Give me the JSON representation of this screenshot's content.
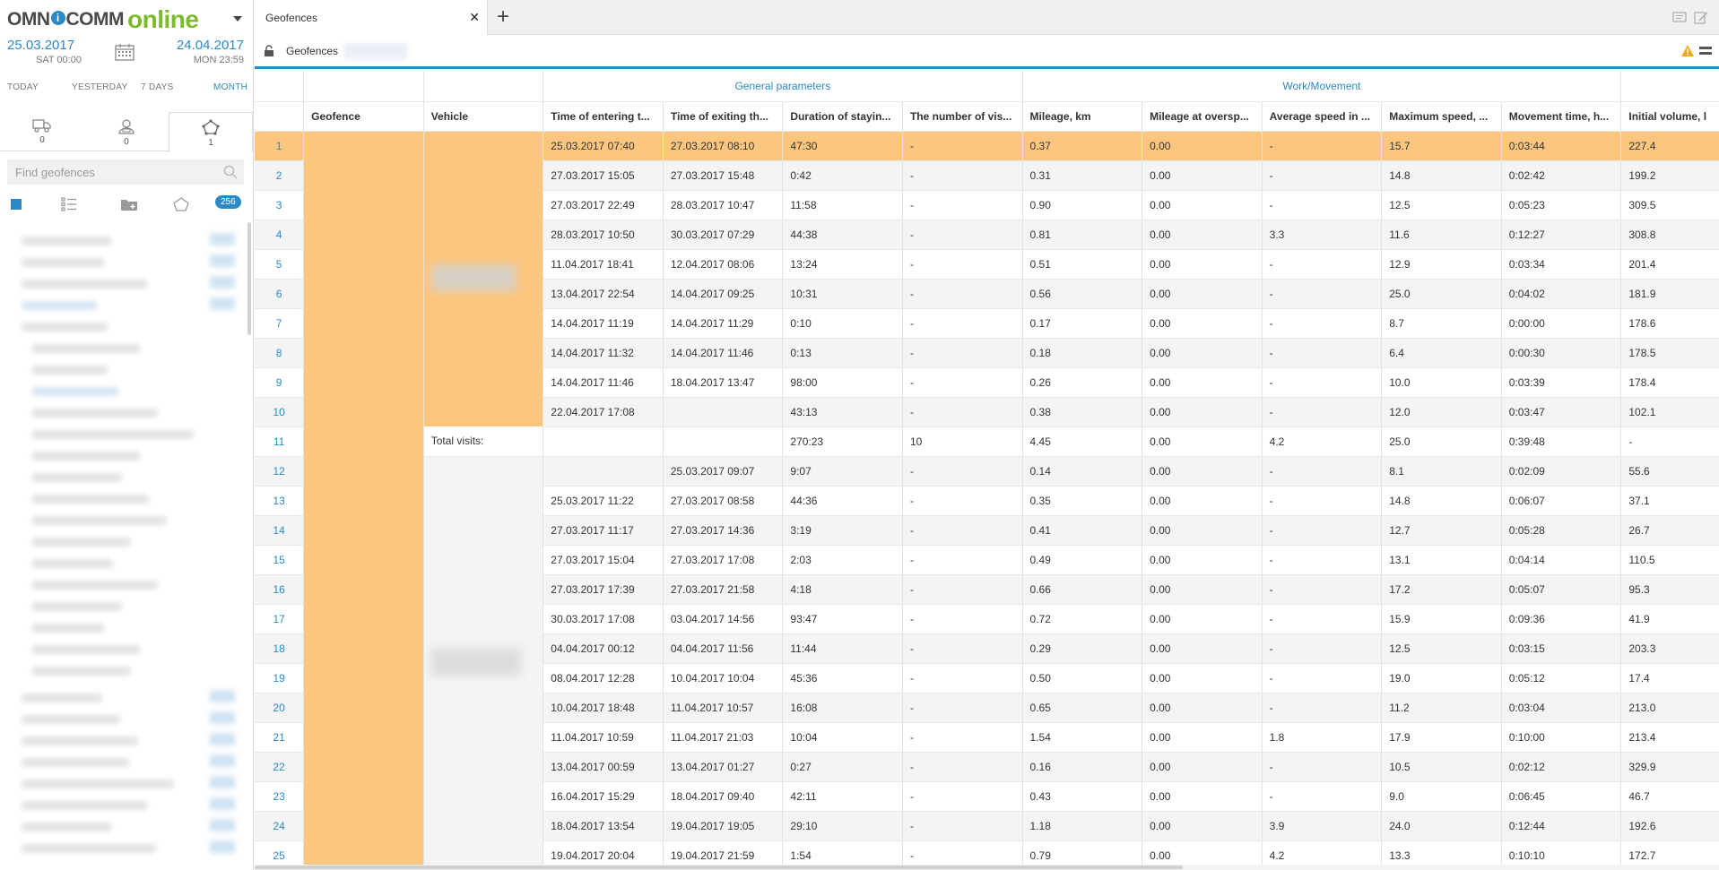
{
  "brand": {
    "part1": "OMN",
    "part_i": "i",
    "part2": "COMM",
    "part3": "online"
  },
  "dates": {
    "from": {
      "date": "25.03.2017",
      "day_time": "SAT 00:00"
    },
    "to": {
      "date": "24.04.2017",
      "day_time": "MON 23:59"
    }
  },
  "periods": [
    "TODAY",
    "YESTERDAY",
    "7 DAYS",
    "MONTH"
  ],
  "object_tabs": [
    {
      "icon": "truck-icon",
      "count": "0"
    },
    {
      "icon": "driver-icon",
      "count": "0"
    },
    {
      "icon": "geofence-icon",
      "count": "1"
    }
  ],
  "search": {
    "placeholder": "Find geofences"
  },
  "list_count": "256",
  "tab": {
    "label": "Geofences"
  },
  "toolbar": {
    "title": "Geofences"
  },
  "colors": {
    "accent": "#2b8ac6",
    "highlight": "#fdc67e",
    "brand_green": "#7dbb2e",
    "warning": "#f5a623"
  },
  "table": {
    "groups": {
      "general": "General parameters",
      "work": "Work/Movement"
    },
    "columns": [
      "Geofence",
      "Vehicle",
      "Time of entering t...",
      "Time of exiting th...",
      "Duration of stayin...",
      "The number of vis...",
      "Mileage, km",
      "Mileage at oversp...",
      "Average speed in ...",
      "Maximum speed, ...",
      "Movement time, h...",
      "Initial volume, l"
    ],
    "total_label": "Total visits:",
    "rows": [
      {
        "n": "1",
        "enter": "25.03.2017 07:40",
        "exit": "27.03.2017 08:10",
        "dur": "47:30",
        "visits": "-",
        "mileage": "0.37",
        "over": "0.00",
        "avg": "-",
        "max": "15.7",
        "move": "0:03:44",
        "vol": "227.4"
      },
      {
        "n": "2",
        "enter": "27.03.2017 15:05",
        "exit": "27.03.2017 15:48",
        "dur": "0:42",
        "visits": "-",
        "mileage": "0.31",
        "over": "0.00",
        "avg": "-",
        "max": "14.8",
        "move": "0:02:42",
        "vol": "199.2"
      },
      {
        "n": "3",
        "enter": "27.03.2017 22:49",
        "exit": "28.03.2017 10:47",
        "dur": "11:58",
        "visits": "-",
        "mileage": "0.90",
        "over": "0.00",
        "avg": "-",
        "max": "12.5",
        "move": "0:05:23",
        "vol": "309.5"
      },
      {
        "n": "4",
        "enter": "28.03.2017 10:50",
        "exit": "30.03.2017 07:29",
        "dur": "44:38",
        "visits": "-",
        "mileage": "0.81",
        "over": "0.00",
        "avg": "3.3",
        "max": "11.6",
        "move": "0:12:27",
        "vol": "308.8"
      },
      {
        "n": "5",
        "enter": "11.04.2017 18:41",
        "exit": "12.04.2017 08:06",
        "dur": "13:24",
        "visits": "-",
        "mileage": "0.51",
        "over": "0.00",
        "avg": "-",
        "max": "12.9",
        "move": "0:03:34",
        "vol": "201.4"
      },
      {
        "n": "6",
        "enter": "13.04.2017 22:54",
        "exit": "14.04.2017 09:25",
        "dur": "10:31",
        "visits": "-",
        "mileage": "0.56",
        "over": "0.00",
        "avg": "-",
        "max": "25.0",
        "move": "0:04:02",
        "vol": "181.9"
      },
      {
        "n": "7",
        "enter": "14.04.2017 11:19",
        "exit": "14.04.2017 11:29",
        "dur": "0:10",
        "visits": "-",
        "mileage": "0.17",
        "over": "0.00",
        "avg": "-",
        "max": "8.7",
        "move": "0:00:00",
        "vol": "178.6"
      },
      {
        "n": "8",
        "enter": "14.04.2017 11:32",
        "exit": "14.04.2017 11:46",
        "dur": "0:13",
        "visits": "-",
        "mileage": "0.18",
        "over": "0.00",
        "avg": "-",
        "max": "6.4",
        "move": "0:00:30",
        "vol": "178.5"
      },
      {
        "n": "9",
        "enter": "14.04.2017 11:46",
        "exit": "18.04.2017 13:47",
        "dur": "98:00",
        "visits": "-",
        "mileage": "0.26",
        "over": "0.00",
        "avg": "-",
        "max": "10.0",
        "move": "0:03:39",
        "vol": "178.4"
      },
      {
        "n": "10",
        "enter": "22.04.2017 17:08",
        "exit": "",
        "dur": "43:13",
        "visits": "-",
        "mileage": "0.38",
        "over": "0.00",
        "avg": "-",
        "max": "12.0",
        "move": "0:03:47",
        "vol": "102.1"
      },
      {
        "n": "11",
        "enter": "",
        "exit": "",
        "dur": "270:23",
        "visits": "10",
        "mileage": "4.45",
        "over": "0.00",
        "avg": "4.2",
        "max": "25.0",
        "move": "0:39:48",
        "vol": "-"
      },
      {
        "n": "12",
        "enter": "",
        "exit": "25.03.2017 09:07",
        "dur": "9:07",
        "visits": "-",
        "mileage": "0.14",
        "over": "0.00",
        "avg": "-",
        "max": "8.1",
        "move": "0:02:09",
        "vol": "55.6"
      },
      {
        "n": "13",
        "enter": "25.03.2017 11:22",
        "exit": "27.03.2017 08:58",
        "dur": "44:36",
        "visits": "-",
        "mileage": "0.35",
        "over": "0.00",
        "avg": "-",
        "max": "14.8",
        "move": "0:06:07",
        "vol": "37.1"
      },
      {
        "n": "14",
        "enter": "27.03.2017 11:17",
        "exit": "27.03.2017 14:36",
        "dur": "3:19",
        "visits": "-",
        "mileage": "0.41",
        "over": "0.00",
        "avg": "-",
        "max": "12.7",
        "move": "0:05:28",
        "vol": "26.7"
      },
      {
        "n": "15",
        "enter": "27.03.2017 15:04",
        "exit": "27.03.2017 17:08",
        "dur": "2:03",
        "visits": "-",
        "mileage": "0.49",
        "over": "0.00",
        "avg": "-",
        "max": "13.1",
        "move": "0:04:14",
        "vol": "110.5"
      },
      {
        "n": "16",
        "enter": "27.03.2017 17:39",
        "exit": "27.03.2017 21:58",
        "dur": "4:18",
        "visits": "-",
        "mileage": "0.66",
        "over": "0.00",
        "avg": "-",
        "max": "17.2",
        "move": "0:05:07",
        "vol": "95.3"
      },
      {
        "n": "17",
        "enter": "30.03.2017 17:08",
        "exit": "03.04.2017 14:56",
        "dur": "93:47",
        "visits": "-",
        "mileage": "0.72",
        "over": "0.00",
        "avg": "-",
        "max": "15.9",
        "move": "0:09:36",
        "vol": "41.9"
      },
      {
        "n": "18",
        "enter": "04.04.2017 00:12",
        "exit": "04.04.2017 11:56",
        "dur": "11:44",
        "visits": "-",
        "mileage": "0.29",
        "over": "0.00",
        "avg": "-",
        "max": "12.5",
        "move": "0:03:15",
        "vol": "203.3"
      },
      {
        "n": "19",
        "enter": "08.04.2017 12:28",
        "exit": "10.04.2017 10:04",
        "dur": "45:36",
        "visits": "-",
        "mileage": "0.50",
        "over": "0.00",
        "avg": "-",
        "max": "19.0",
        "move": "0:05:12",
        "vol": "17.4"
      },
      {
        "n": "20",
        "enter": "10.04.2017 18:48",
        "exit": "11.04.2017 10:57",
        "dur": "16:08",
        "visits": "-",
        "mileage": "0.65",
        "over": "0.00",
        "avg": "-",
        "max": "11.2",
        "move": "0:03:04",
        "vol": "213.0"
      },
      {
        "n": "21",
        "enter": "11.04.2017 10:59",
        "exit": "11.04.2017 21:03",
        "dur": "10:04",
        "visits": "-",
        "mileage": "1.54",
        "over": "0.00",
        "avg": "1.8",
        "max": "17.9",
        "move": "0:10:00",
        "vol": "213.4"
      },
      {
        "n": "22",
        "enter": "13.04.2017 00:59",
        "exit": "13.04.2017 01:27",
        "dur": "0:27",
        "visits": "-",
        "mileage": "0.16",
        "over": "0.00",
        "avg": "-",
        "max": "10.5",
        "move": "0:02:12",
        "vol": "329.9"
      },
      {
        "n": "23",
        "enter": "16.04.2017 15:29",
        "exit": "18.04.2017 09:40",
        "dur": "42:11",
        "visits": "-",
        "mileage": "0.43",
        "over": "0.00",
        "avg": "-",
        "max": "9.0",
        "move": "0:06:45",
        "vol": "46.7"
      },
      {
        "n": "24",
        "enter": "18.04.2017 13:54",
        "exit": "19.04.2017 19:05",
        "dur": "29:10",
        "visits": "-",
        "mileage": "1.18",
        "over": "0.00",
        "avg": "3.9",
        "max": "24.0",
        "move": "0:12:44",
        "vol": "192.6"
      },
      {
        "n": "25",
        "enter": "19.04.2017 20:04",
        "exit": "19.04.2017 21:59",
        "dur": "1:54",
        "visits": "-",
        "mileage": "0.79",
        "over": "0.00",
        "avg": "4.2",
        "max": "13.3",
        "move": "0:10:10",
        "vol": "172.7"
      }
    ]
  }
}
